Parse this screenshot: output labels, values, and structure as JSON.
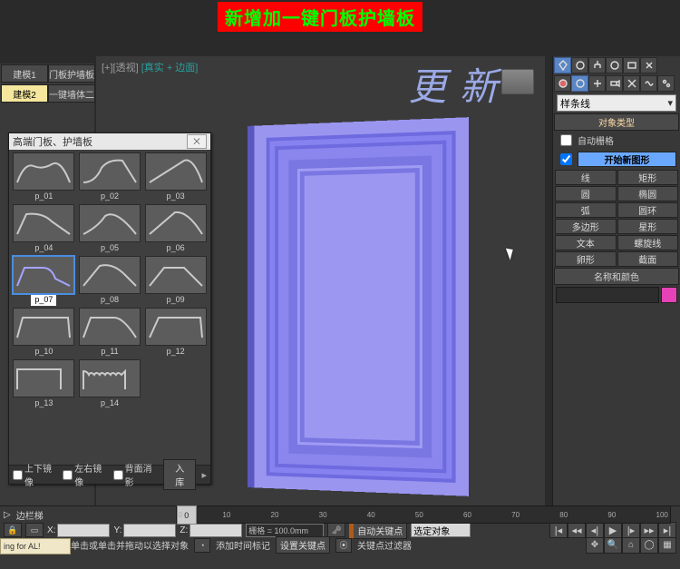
{
  "banner": "新增加一键门板护墙板",
  "left_tabs_col1": [
    "建模1",
    "建模2"
  ],
  "left_tabs_col2": [
    "门板护墙板",
    "一键墙体二"
  ],
  "active_left_col1_index": 1,
  "viewport": {
    "label_prefix": "[+][透视]",
    "label_teal": "[真实 + 边面]",
    "watermark": "更 新"
  },
  "palette": {
    "title": "高端门板、护墙板",
    "close": "⨉",
    "items": [
      {
        "name": "p_01"
      },
      {
        "name": "p_02"
      },
      {
        "name": "p_03"
      },
      {
        "name": "p_04"
      },
      {
        "name": "p_05"
      },
      {
        "name": "p_06"
      },
      {
        "name": "p_07",
        "selected": true
      },
      {
        "name": "p_08"
      },
      {
        "name": "p_09"
      },
      {
        "name": "p_10"
      },
      {
        "name": "p_11"
      },
      {
        "name": "p_12"
      },
      {
        "name": "p_13"
      },
      {
        "name": "p_14"
      }
    ],
    "footer": {
      "chk1": "上下镜像",
      "chk2": "左右镜像",
      "chk3": "背面消影",
      "btn": "入库"
    }
  },
  "cmd": {
    "dropdown": "样条线",
    "section_object": "对象类型",
    "autogrid": "自动栅格",
    "start_new": "开始新图形",
    "shapes": [
      "线",
      "矩形",
      "圆",
      "椭圆",
      "弧",
      "圆环",
      "多边形",
      "星形",
      "文本",
      "螺旋线",
      "卵形",
      "截面"
    ],
    "section_name": "名称和颜色"
  },
  "bottom": {
    "track_label": "边栏梯",
    "slider_value": "0",
    "frame_numbers": [
      "0",
      "10",
      "20",
      "30",
      "40",
      "50",
      "60",
      "70",
      "80",
      "90",
      "100"
    ],
    "coord": {
      "x": "X:",
      "y": "Y:",
      "z": "Z:",
      "grid": "栅格 = 100.0mm"
    },
    "autokey": "自动关键点",
    "setkey": "设置关键点",
    "select_obj": "选定对象",
    "keytag": "添加时间标记",
    "keyfilter": "关键点过滤器",
    "status": "单击或单击并拖动以选择对象",
    "status_left": "ing for AL!"
  }
}
